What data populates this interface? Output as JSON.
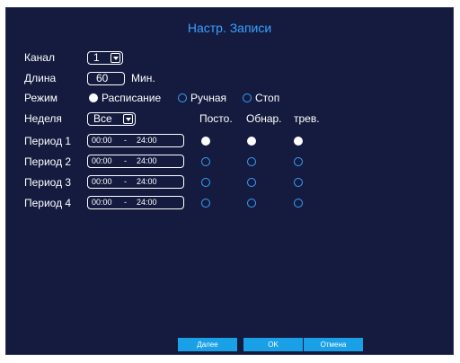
{
  "title": "Настр. Записи",
  "channel": {
    "label": "Канал",
    "value": "1",
    "icon": "chevron-down-icon"
  },
  "length": {
    "label": "Длина",
    "value": "60",
    "unit": "Мин."
  },
  "mode": {
    "label": "Режим",
    "options": [
      {
        "label": "Расписание",
        "selected": true
      },
      {
        "label": "Ручная",
        "selected": false
      },
      {
        "label": "Стоп",
        "selected": false
      }
    ]
  },
  "week": {
    "label": "Неделя",
    "value": "Все",
    "icon": "chevron-down-icon"
  },
  "columns": [
    "Посто.",
    "Обнар.",
    "трев."
  ],
  "periods": [
    {
      "label": "Период 1",
      "start": "00:00",
      "sep": "-",
      "end": "24:00",
      "flags": [
        true,
        true,
        true
      ]
    },
    {
      "label": "Период 2",
      "start": "00:00",
      "sep": "-",
      "end": "24:00",
      "flags": [
        false,
        false,
        false
      ]
    },
    {
      "label": "Период 3",
      "start": "00:00",
      "sep": "-",
      "end": "24:00",
      "flags": [
        false,
        false,
        false
      ]
    },
    {
      "label": "Период 4",
      "start": "00:00",
      "sep": "-",
      "end": "24:00",
      "flags": [
        false,
        false,
        false
      ]
    }
  ],
  "buttons": {
    "next": "Далее",
    "ok": "OK",
    "cancel": "Отмена"
  },
  "colors": {
    "background": "#141b3f",
    "accent": "#3aa0ff",
    "button": "#1aa0e6",
    "text": "#ffffff"
  }
}
